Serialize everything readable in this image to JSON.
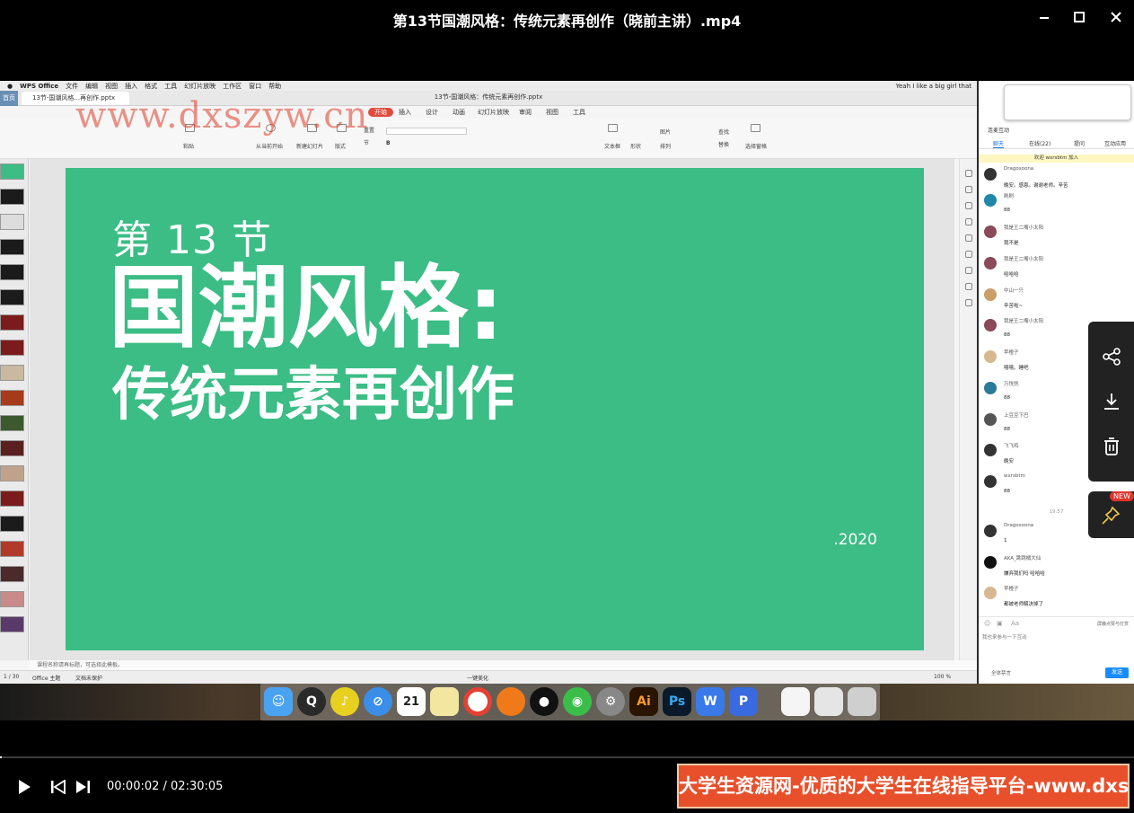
{
  "player": {
    "title": "第13节国潮风格：传统元素再创作（晓前主讲）.mp4",
    "time_current": "00:00:02",
    "time_total": "02:30:05",
    "time_display": "00:00:02 / 02:30:05",
    "progress": 0.0002,
    "banner": "大学生资源网-优质的大学生在线指导平台-www.dxszyw.cn",
    "watermark": "www.dxszyw.cn"
  },
  "mac_menu": {
    "items": [
      "WPS Office",
      "文件",
      "编辑",
      "视图",
      "插入",
      "格式",
      "工具",
      "幻灯片放映",
      "工作区",
      "窗口",
      "帮助"
    ],
    "right_text": "Yeah I like a big girl that"
  },
  "wps": {
    "home_tab": "首页",
    "doc_tab": "13节-国潮风格...再创作.pptx",
    "doc_title": "13节-国潮风格：传统元素再创作.pptx",
    "ribbon_tabs": [
      "开始",
      "插入",
      "设计",
      "动画",
      "幻灯片放映",
      "审阅",
      "视图",
      "工具"
    ],
    "ribbon_labels": [
      "粘贴",
      "从当前开始",
      "新建幻灯片",
      "版式",
      "重置",
      "节",
      "文本框",
      "形状",
      "图片",
      "排列",
      "查找",
      "替换",
      "选择窗格"
    ],
    "notes": "课程名称请再标题，可选择此模板。",
    "status_page": "1 / 30",
    "status_theme": "Office 主题",
    "status_protect": "文档未保护",
    "status_beautify": "一键美化",
    "status_zoom": "100 %"
  },
  "slide": {
    "section": "第 13 节",
    "title_line1": "国潮风格:",
    "title_line2": "传统元素再创作",
    "year": ".2020",
    "bg_color": "#3bbd85"
  },
  "chat": {
    "header": "连麦互动",
    "tabs": [
      "聊天",
      "在线(22)",
      "提问",
      "互动应用"
    ],
    "welcome": "欢迎 wxrsbtm 加入",
    "messages": [
      {
        "name": "Dragosoona",
        "text": "晚安。感恩。谢谢老师。辛苦"
      },
      {
        "name": "刷刷",
        "text": "88"
      },
      {
        "name": "我是王二嘴小太阳",
        "text": "我不是"
      },
      {
        "name": "我是王二嘴小太阳",
        "text": "哈哈哈"
      },
      {
        "name": "中山一只",
        "text": "辛苦啦~"
      },
      {
        "name": "我是王二嘴小太阳",
        "text": "88"
      },
      {
        "name": "苹橙子",
        "text": "嘻嘻。睡吧"
      },
      {
        "name": "万恍恍",
        "text": "88"
      },
      {
        "name": "上豆豆下巴",
        "text": "88"
      },
      {
        "name": "飞飞鸡",
        "text": "晚安"
      },
      {
        "name": "wxrsbtm",
        "text": "88"
      }
    ],
    "time_marker": "19:57",
    "late_messages": [
      {
        "name": "Dragosoona",
        "text": "1"
      },
      {
        "name": "AKA_跳跳橘大仙",
        "text": "嫌弃我们吗 哈哈哈"
      },
      {
        "name": "苹橙子",
        "text": "都被老师解决掉了"
      }
    ],
    "input_placeholder": "我也来参与一下互动",
    "shield_label": "屏蔽点赞与打赏",
    "all_mute": "全体禁言",
    "send": "发送"
  },
  "fab": {
    "new_badge": "NEW"
  },
  "dock_apps": [
    "finder-icon",
    "quicktime-icon",
    "music-icon",
    "safari-icon",
    "calendar-icon",
    "notes-icon",
    "chrome-icon",
    "firefox-icon",
    "qq-icon",
    "wechat-icon",
    "settings-icon",
    "illustrator-icon",
    "photoshop-icon",
    "wps-icon",
    "pages-icon",
    "preview-icon",
    "file-icon",
    "trash-icon"
  ],
  "dock_labels": {
    "calendar": "21",
    "illustrator": "Ai",
    "photoshop": "Ps",
    "wps": "W",
    "pages": "P"
  }
}
